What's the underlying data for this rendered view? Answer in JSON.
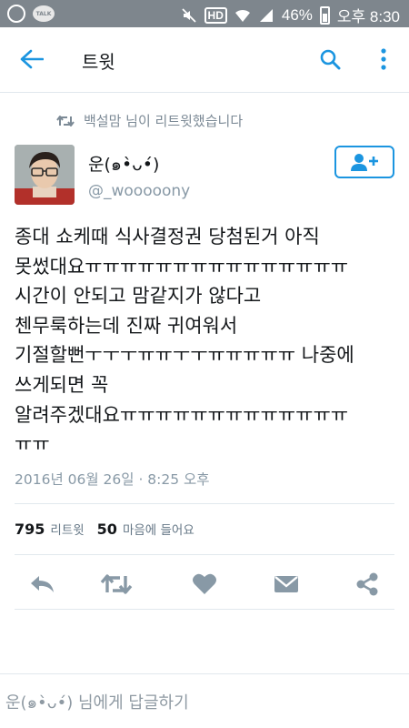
{
  "status_bar": {
    "talk_label": "TALK",
    "hd_label": "HD",
    "battery": "46%",
    "time": "오후 8:30"
  },
  "app_bar": {
    "title": "트윗"
  },
  "retweet_context": "백설맘 님이 리트윗했습니다",
  "tweet": {
    "author_name": "운(๑•̀ᴗ•́)",
    "author_handle": "@_wooooony",
    "lines": [
      "종대 쇼케때 식사결정권 당첨된거 아직",
      "못썼대요ㅠㅠㅠㅠㅠㅠㅠㅠㅠㅠㅠㅠㅠㅠㅠ",
      "시간이 안되고 맘같지가 않다고",
      "첸무룩하는데 진짜 귀여워서",
      "기절할뻔ㅜㅜㅜㅠㅠㅜㅜㅠㅠㅠㅠㅠ 나중에",
      "쓰게되면 꼭",
      "알려주겠대요ㅠㅠㅠㅠㅠㅠㅠㅠㅠㅠㅠㅠㅠ",
      "ㅠㅠ"
    ],
    "timestamp": "2016년 06월 26일 · 8:25 오후",
    "retweet_count": "795",
    "retweet_label": "리트윗",
    "like_count": "50",
    "like_label": "마음에 들어요"
  },
  "colors": {
    "accent": "#1b95e0",
    "action_icon": "#8899a6",
    "status_bar": "#7e868d"
  },
  "icons": {
    "back": "arrow-left-icon",
    "search": "search-icon",
    "more": "more-vertical-icon",
    "follow": "add-user-icon",
    "reply": "reply-icon",
    "retweet": "retweet-icon",
    "like": "heart-icon",
    "message": "direct-message-icon",
    "share": "share-icon"
  },
  "reply_bar": {
    "placeholder": "운(๑•̀ᴗ•́) 님에게 답글하기"
  }
}
